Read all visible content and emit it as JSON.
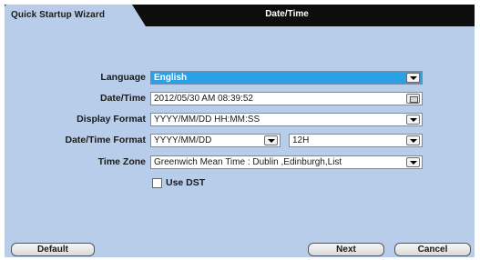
{
  "tab": {
    "label": "Quick Startup Wizard"
  },
  "title": "Date/Time",
  "form": {
    "language": {
      "label": "Language",
      "value": "English"
    },
    "datetime": {
      "label": "Date/Time",
      "value": "2012/05/30 AM 08:39:52"
    },
    "display_format": {
      "label": "Display Format",
      "value": "YYYY/MM/DD HH:MM:SS"
    },
    "datetime_format": {
      "label": "Date/Time Format",
      "date_value": "YYYY/MM/DD",
      "hour_value": "12H"
    },
    "timezone": {
      "label": "Time Zone",
      "value": "Greenwich Mean Time : Dublin ,Edinburgh,List"
    },
    "dst": {
      "label": "Use DST",
      "checked": false
    }
  },
  "buttons": {
    "default": "Default",
    "next": "Next",
    "cancel": "Cancel"
  },
  "colors": {
    "background": "#b7cde9",
    "titlebar": "#0d0d0d",
    "selected": "#2aa1e6"
  }
}
